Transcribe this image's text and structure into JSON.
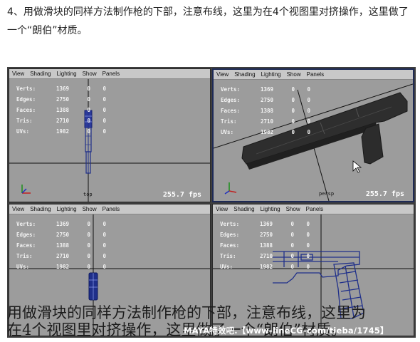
{
  "intro": {
    "text": "4、用做滑块的同样方法制作枪的下部，注意布线，这里为在4个视图里对挤操作，这里做了一个“朗伯”材质。"
  },
  "viewports": [
    {
      "menu": [
        "View",
        "Shading",
        "Lighting",
        "Show",
        "Panels"
      ],
      "camera": "top",
      "fps": "255.7 fps",
      "stats": [
        {
          "label": "Verts:",
          "v1": "1369",
          "v2": "0",
          "v3": "0"
        },
        {
          "label": "Edges:",
          "v1": "2750",
          "v2": "0",
          "v3": "0"
        },
        {
          "label": "Faces:",
          "v1": "1388",
          "v2": "0",
          "v3": "0"
        },
        {
          "label": "Tris:",
          "v1": "2710",
          "v2": "0",
          "v3": "0"
        },
        {
          "label": "UVs:",
          "v1": "1982",
          "v2": "0",
          "v3": "0"
        }
      ]
    },
    {
      "menu": [
        "View",
        "Shading",
        "Lighting",
        "Show",
        "Panels"
      ],
      "camera": "persp",
      "fps": "255.7 fps",
      "stats": [
        {
          "label": "Verts:",
          "v1": "1369",
          "v2": "0",
          "v3": "0"
        },
        {
          "label": "Edges:",
          "v1": "2750",
          "v2": "0",
          "v3": "0"
        },
        {
          "label": "Faces:",
          "v1": "1388",
          "v2": "0",
          "v3": "0"
        },
        {
          "label": "Tris:",
          "v1": "2710",
          "v2": "0",
          "v3": "0"
        },
        {
          "label": "UVs:",
          "v1": "1982",
          "v2": "0",
          "v3": "0"
        }
      ]
    },
    {
      "menu": [
        "View",
        "Shading",
        "Lighting",
        "Show",
        "Panels"
      ],
      "camera": "",
      "fps": "",
      "stats": [
        {
          "label": "Verts:",
          "v1": "1369",
          "v2": "0",
          "v3": "0"
        },
        {
          "label": "Edges:",
          "v1": "2750",
          "v2": "0",
          "v3": "0"
        },
        {
          "label": "Faces:",
          "v1": "1388",
          "v2": "0",
          "v3": "0"
        },
        {
          "label": "Tris:",
          "v1": "2710",
          "v2": "0",
          "v3": "0"
        },
        {
          "label": "UVs:",
          "v1": "1982",
          "v2": "0",
          "v3": "0"
        }
      ]
    },
    {
      "menu": [
        "View",
        "Shading",
        "Lighting",
        "Show",
        "Panels"
      ],
      "camera": "",
      "fps": "",
      "stats": [
        {
          "label": "Verts:",
          "v1": "1369",
          "v2": "0",
          "v3": "0"
        },
        {
          "label": "Edges:",
          "v1": "2750",
          "v2": "0",
          "v3": "0"
        },
        {
          "label": "Faces:",
          "v1": "1388",
          "v2": "0",
          "v3": "0"
        },
        {
          "label": "Tris:",
          "v1": "2710",
          "v2": "0",
          "v3": "0"
        },
        {
          "label": "UVs:",
          "v1": "1982",
          "v2": "0",
          "v3": "0"
        }
      ]
    }
  ],
  "overlay": {
    "line1": "用做滑块的同样方法制作枪的下部，注意布线，这里为",
    "line2": "在4个视图里对挤操作，这里做了一个“朗伯”材质。"
  },
  "watermark": "MAYA特效吧.【www-lineCG-com/tieba/1745】",
  "colors": {
    "viewport_bg": "#9c9c9c",
    "menubar_bg": "#c8c8c8",
    "active_border": "#1e2a55",
    "wireframe": "#1f2f8a",
    "model_dark": "#2a2a2a"
  }
}
